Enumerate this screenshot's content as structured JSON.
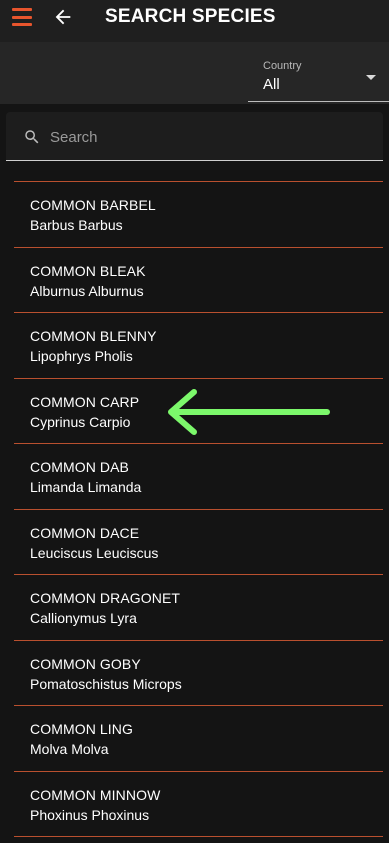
{
  "header": {
    "title": "SEARCH SPECIES",
    "menu_icon": "hamburger-menu-icon",
    "back_icon": "arrow-left-icon"
  },
  "filter": {
    "country_label": "Country",
    "country_value": "All"
  },
  "search": {
    "placeholder": "Search",
    "value": ""
  },
  "species": [
    {
      "common": "COMMON BARBEL",
      "latin": "Barbus Barbus"
    },
    {
      "common": "COMMON BLEAK",
      "latin": "Alburnus Alburnus"
    },
    {
      "common": "COMMON BLENNY",
      "latin": "Lipophrys Pholis"
    },
    {
      "common": "COMMON CARP",
      "latin": "Cyprinus Carpio"
    },
    {
      "common": "COMMON DAB",
      "latin": "Limanda Limanda"
    },
    {
      "common": "COMMON DACE",
      "latin": "Leuciscus Leuciscus"
    },
    {
      "common": "COMMON DRAGONET",
      "latin": "Callionymus Lyra"
    },
    {
      "common": "COMMON GOBY",
      "latin": "Pomatoschistus Microps"
    },
    {
      "common": "COMMON LING",
      "latin": "Molva Molva"
    },
    {
      "common": "COMMON MINNOW",
      "latin": "Phoxinus Phoxinus"
    }
  ],
  "colors": {
    "accent": "#e8552d",
    "divider": "#b9502f",
    "annotation": "#7cf86b",
    "background": "#141414"
  },
  "annotation": {
    "icon": "arrow-left-annotation",
    "points_to_item": 3
  }
}
